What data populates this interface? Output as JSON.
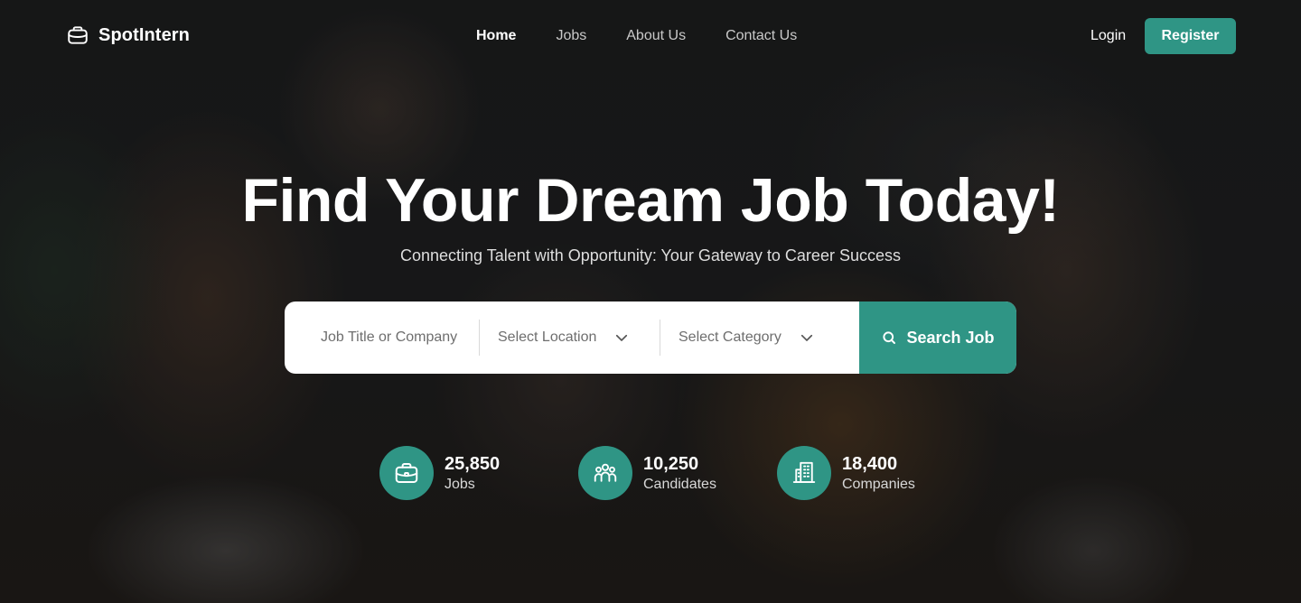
{
  "brand": {
    "name": "SpotIntern"
  },
  "nav": {
    "items": [
      {
        "label": "Home",
        "active": true
      },
      {
        "label": "Jobs",
        "active": false
      },
      {
        "label": "About Us",
        "active": false
      },
      {
        "label": "Contact Us",
        "active": false
      }
    ]
  },
  "auth": {
    "login": "Login",
    "register": "Register"
  },
  "hero": {
    "title": "Find Your Dream Job Today!",
    "subtitle": "Connecting Talent with Opportunity: Your Gateway to Career Success"
  },
  "search": {
    "job_placeholder": "Job Title or Company",
    "location_placeholder": "Select Location",
    "category_placeholder": "Select Category",
    "button": "Search Job"
  },
  "stats": [
    {
      "value": "25,850",
      "label": "Jobs",
      "icon": "briefcase-icon"
    },
    {
      "value": "10,250",
      "label": "Candidates",
      "icon": "users-icon"
    },
    {
      "value": "18,400",
      "label": "Companies",
      "icon": "building-icon"
    }
  ],
  "colors": {
    "accent": "#2f9585",
    "text": "#ffffff"
  }
}
